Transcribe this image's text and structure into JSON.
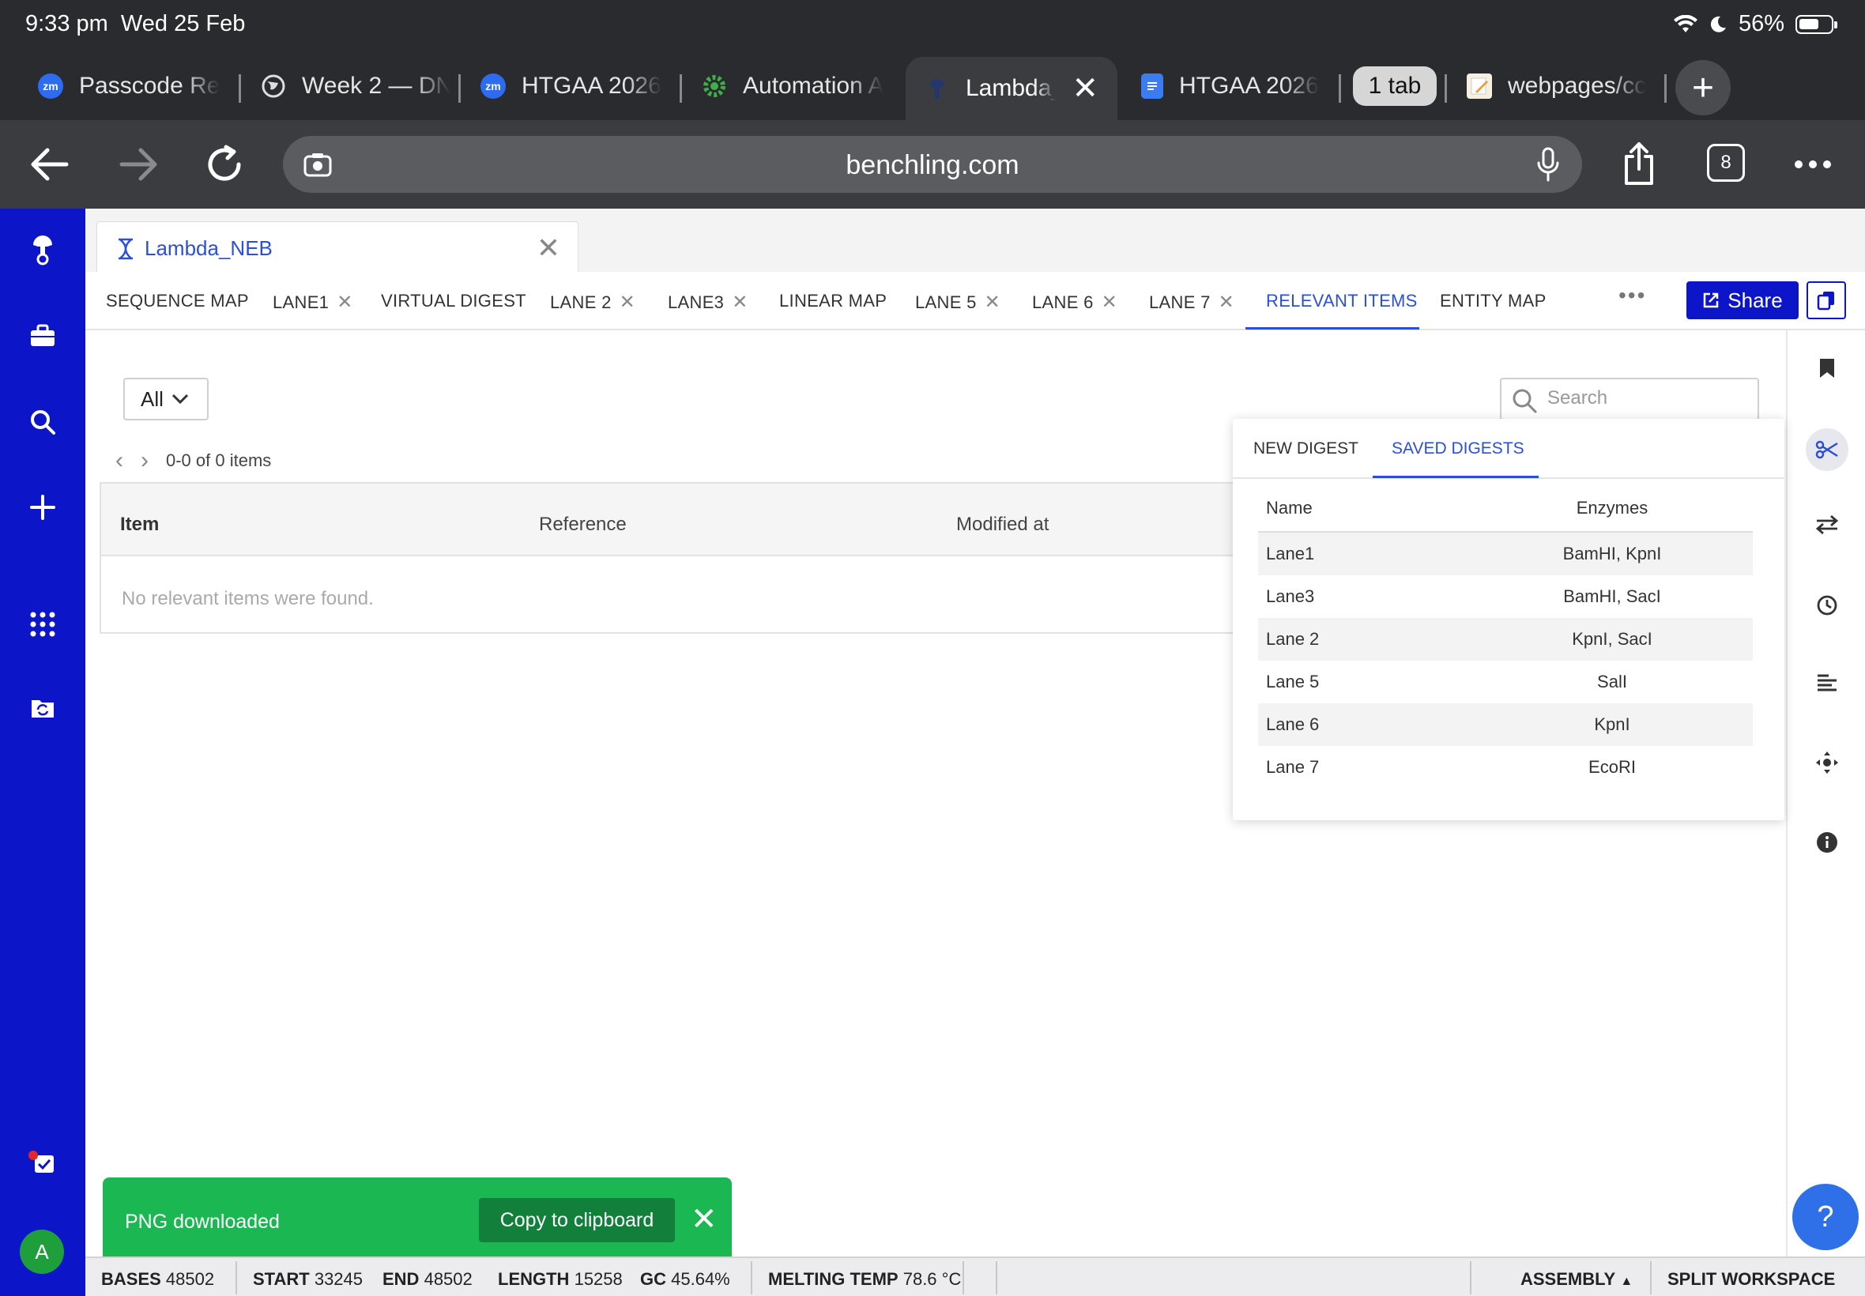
{
  "status_bar": {
    "time": "9:33 pm",
    "date": "Wed 25 Feb",
    "battery": "56%"
  },
  "browser_tabs": [
    {
      "label": "Passcode Re",
      "favicon": "zoom-icon"
    },
    {
      "label": "Week 2 — DN",
      "favicon": "globe-icon"
    },
    {
      "label": "HTGAA 2026",
      "favicon": "zoom-icon"
    },
    {
      "label": "Automation A",
      "favicon": "gear-icon"
    },
    {
      "label": "Lambda_",
      "favicon": "benchling-icon",
      "active": true
    },
    {
      "label": "HTGAA 2026",
      "favicon": "google-docs-icon"
    },
    {
      "label": "webpages/cc",
      "favicon": "notepad-icon"
    }
  ],
  "tab_group_label": "1 tab",
  "address_bar": {
    "url": "benchling.com",
    "open_tab_count": "8"
  },
  "document_tab": {
    "name": "Lambda_NEB"
  },
  "view_tabs": [
    {
      "label": "SEQUENCE MAP",
      "closable": false
    },
    {
      "label": "LANE1",
      "closable": true
    },
    {
      "label": "VIRTUAL DIGEST",
      "closable": false
    },
    {
      "label": "LANE 2",
      "closable": true
    },
    {
      "label": "LANE3",
      "closable": true
    },
    {
      "label": "LINEAR MAP",
      "closable": false
    },
    {
      "label": "LANE 5",
      "closable": true
    },
    {
      "label": "LANE 6",
      "closable": true
    },
    {
      "label": "LANE 7",
      "closable": true
    },
    {
      "label": "RELEVANT ITEMS",
      "closable": false,
      "active": true
    },
    {
      "label": "ENTITY MAP",
      "closable": false
    }
  ],
  "share_label": "Share",
  "filter": {
    "selected": "All"
  },
  "search": {
    "placeholder": "Search"
  },
  "pager": {
    "text": "0-0 of 0 items"
  },
  "relevant_table": {
    "columns": [
      "Item",
      "Reference",
      "Modified at"
    ],
    "empty_message": "No relevant items were found."
  },
  "digest_panel": {
    "tabs": [
      "NEW DIGEST",
      "SAVED DIGESTS"
    ],
    "active_tab": "SAVED DIGESTS",
    "columns": [
      "Name",
      "Enzymes"
    ],
    "rows": [
      {
        "name": "Lane1",
        "enzymes": "BamHI, KpnI"
      },
      {
        "name": "Lane3",
        "enzymes": "BamHI, SacI"
      },
      {
        "name": "Lane 2",
        "enzymes": "KpnI, SacI"
      },
      {
        "name": "Lane 5",
        "enzymes": "SalI"
      },
      {
        "name": "Lane 6",
        "enzymes": "KpnI"
      },
      {
        "name": "Lane 7",
        "enzymes": "EcoRI"
      }
    ]
  },
  "toast": {
    "message": "PNG downloaded",
    "action": "Copy to clipboard"
  },
  "user_initial": "A",
  "help_label": "?",
  "bottom_bar": {
    "bases_label": "BASES",
    "bases": "48502",
    "start_label": "START",
    "start": "33245",
    "end_label": "END",
    "end": "48502",
    "length_label": "LENGTH",
    "length": "15258",
    "gc_label": "GC",
    "gc": "45.64%",
    "melting_label": "MELTING TEMP",
    "melting": "78.6 °C",
    "assembly": "ASSEMBLY",
    "split": "SPLIT WORKSPACE"
  },
  "colors": {
    "benchling_blue": "#0c16c8",
    "link_blue": "#2b4fd8",
    "toast_green": "#1ab752",
    "chrome_dark": "#2a2b2e"
  }
}
